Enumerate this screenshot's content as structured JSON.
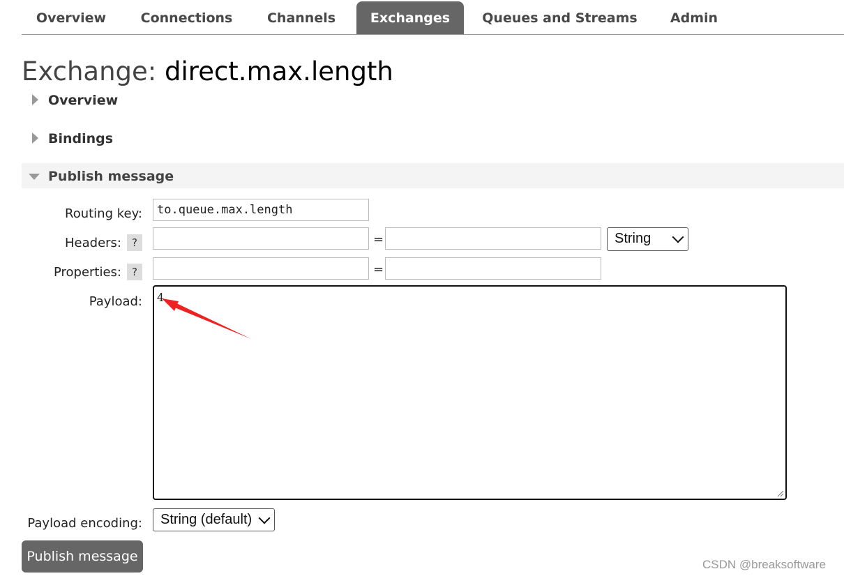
{
  "nav": {
    "tabs": [
      {
        "label": "Overview"
      },
      {
        "label": "Connections"
      },
      {
        "label": "Channels"
      },
      {
        "label": "Exchanges"
      },
      {
        "label": "Queues and Streams"
      },
      {
        "label": "Admin"
      }
    ],
    "active": "Exchanges"
  },
  "page": {
    "title_prefix": "Exchange:",
    "title_name": "direct.max.length"
  },
  "sections": {
    "overview": "Overview",
    "bindings": "Bindings",
    "publish": "Publish message"
  },
  "form": {
    "routing_key_label": "Routing key:",
    "routing_key_value": "to.queue.max.length",
    "headers_label": "Headers:",
    "properties_label": "Properties:",
    "help_glyph": "?",
    "equals": "=",
    "header_type": "String",
    "payload_label": "Payload:",
    "payload_value": "4",
    "encoding_label": "Payload encoding:",
    "encoding_value": "String (default)",
    "submit_label": "Publish message"
  },
  "watermark": "CSDN @breaksoftware",
  "colors": {
    "active_tab": "#666666",
    "button": "#666666",
    "annotation_arrow": "#ee2222"
  }
}
